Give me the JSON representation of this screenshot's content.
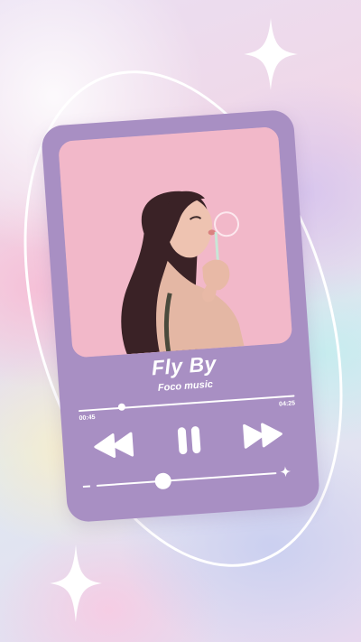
{
  "song": {
    "title": "Fly By",
    "artist": "Foco music"
  },
  "playback": {
    "elapsed": "00:45",
    "duration": "04:25",
    "progress_fraction": 0.2,
    "is_playing": true
  },
  "volume": {
    "level_fraction": 0.37
  },
  "icons": {
    "rewind": "rewind-icon",
    "pause": "pause-icon",
    "fast_forward": "fast-forward-icon",
    "volume_down": "minus-icon",
    "volume_up": "plus-icon",
    "sparkle": "sparkle-icon"
  },
  "colors": {
    "card": "#a88fc3",
    "accent": "#ffffff",
    "photo_background": "#f2b8c9"
  }
}
